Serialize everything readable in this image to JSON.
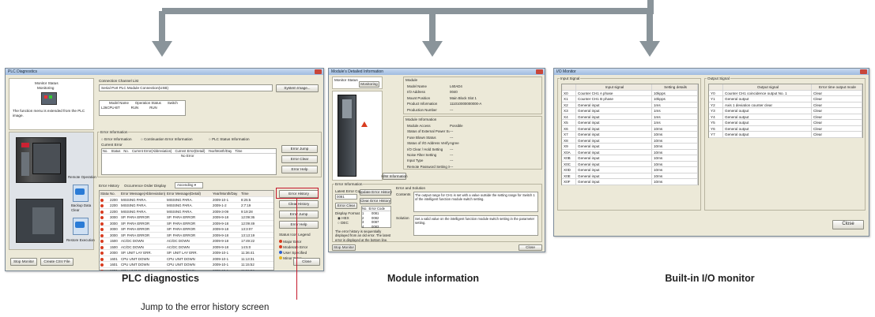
{
  "captions": {
    "plc": "PLC diagnostics",
    "module": "Module information",
    "io": "Built-in I/O monitor",
    "jump": "Jump to the error history screen"
  },
  "plc_window": {
    "title": "PLC Diagnostics",
    "monitor_status": "Monitor Status",
    "monitoring": "Monitoring",
    "function_note": "The function menu is extended from the PLC image.",
    "connection_channel": "Connection Channel List",
    "connection_value": "Serial Port  PLC Module Connection(USB)",
    "system_image": "System Image...",
    "model_headers": [
      "Model Name",
      "Operation Status",
      "Switch"
    ],
    "model_values": [
      "L26CPU-BT",
      "RUN",
      "RUN"
    ],
    "error_information": "Error Information",
    "radio_error": "Error Information",
    "radio_continuation": "Continuation Error Information",
    "radio_status": "PLC Status Information",
    "current_error": "Current Error",
    "ce_headers": [
      "No.",
      "Status",
      "No.",
      "Current Error(Abbreviation)",
      "Current Error(Detail)",
      "Year/Month/Day",
      "Time"
    ],
    "no_error": "No Error",
    "error_jump": "Error Jump",
    "error_clear": "Error Clear",
    "error_help": "Error Help",
    "remote_operation": "Remote Operation",
    "backup_data": "Backup Data Clear",
    "restore_execution": "Restore Execution",
    "error_history": "Error History",
    "occurrence_order": "Occurrence Order Display",
    "order_value": "Ascending",
    "eh_headers": [
      "Status",
      "No.",
      "Error Message(Abbreviation)",
      "Error Message(Detail)",
      "Year/Month/Day",
      "Time"
    ],
    "eh_rows": [
      [
        "2200",
        "MISSING PARA.",
        "MISSING PARA.",
        "2009-10-1",
        "8:25:5"
      ],
      [
        "2200",
        "MISSING PARA.",
        "MISSING PARA.",
        "2009-1-2",
        "2:7:19"
      ],
      [
        "2200",
        "MISSING PARA.",
        "MISSING PARA.",
        "2009-3-09",
        "9:19:28"
      ],
      [
        "3000",
        "SP. PARA ERROR",
        "SP. PARA ERROR",
        "2009-9-18",
        "12:09:36"
      ],
      [
        "3000",
        "SP. PARA ERROR",
        "SP. PARA ERROR",
        "2009-9-18",
        "12:09:49"
      ],
      [
        "3000",
        "SP. PARA ERROR",
        "SP. PARA ERROR",
        "2009-9-18",
        "13:3:07"
      ],
      [
        "3000",
        "SP. PARA ERROR",
        "SP. PARA ERROR",
        "2009-9-18",
        "13:13:19"
      ],
      [
        "1500",
        "AC/DC DOWN",
        "AC/DC DOWN",
        "2009-9-18",
        "17:49:22"
      ],
      [
        "1500",
        "AC/DC DOWN",
        "AC/DC DOWN",
        "2009-9-18",
        "14:5:0"
      ],
      [
        "2000",
        "SP. UNIT LAY ERR.",
        "SP. UNIT LAY ERR.",
        "2009-10-1",
        "11:36:41"
      ],
      [
        "1601",
        "CPU UNIT DOWN",
        "CPU UNIT DOWN",
        "2009-10-1",
        "11:13:31"
      ],
      [
        "1601",
        "CPU UNIT DOWN",
        "CPU UNIT DOWN",
        "2009-10-1",
        "11:15:52"
      ],
      [
        "1601",
        "CPU UNIT DOWN",
        "CPU UNIT DOWN",
        "2009-10-1",
        "11:21:34"
      ]
    ],
    "right_buttons": [
      "Error History",
      "Clear History",
      "Error Jump",
      "Error Help"
    ],
    "status_icon_legend": "Status Icon Legend",
    "legend": [
      "Major Error",
      "Moderate Error",
      "User Specified",
      "Minor Error"
    ],
    "stop_monitor": "Stop Monitor",
    "create_csv": "Create CSV File",
    "close": "Close"
  },
  "module_window": {
    "title": "Module's Detailed Information",
    "monitor_status": "Monitor Status",
    "monitoring": "Monitoring",
    "module_group": "Module",
    "module_rows": [
      [
        "Model Name",
        "L60AD4"
      ],
      [
        "I/O Address",
        "0040"
      ],
      [
        "Mount Position",
        "Main Block Slot 1"
      ],
      [
        "Product Information",
        "111010000000000-A"
      ],
      [
        "Production Number",
        "---"
      ]
    ],
    "module_info_group": "Module Information",
    "info_rows": [
      [
        "Module Access",
        "Possible"
      ],
      [
        "Status of External Power Supply",
        "---"
      ],
      [
        "Fuse Blown Status",
        "---"
      ],
      [
        "Status of I/O Address Verify",
        "Agree"
      ],
      [
        "I/O Clear / Hold Setting",
        "---"
      ],
      [
        "Noise Filter Setting",
        "---"
      ],
      [
        "Input Type",
        "---"
      ],
      [
        "Remote Password Setting Status",
        "---"
      ]
    ],
    "h_w_information": "H/W Information",
    "error_information": "Error Information",
    "latest_error_code": "Latest Error Code",
    "latest_value": "0081",
    "update_error_history": "Update Error History",
    "error_clear": "Error Clear",
    "clear_error_history": "Clear Error History",
    "display_format": "Display Format",
    "hex": "HEX",
    "dec": "DEC",
    "eh_headers": [
      "No.",
      "Error Code"
    ],
    "eh_rows": [
      [
        "1",
        "0081"
      ],
      [
        "2",
        "0082"
      ],
      [
        "3",
        "0087"
      ],
      [
        "4",
        "0083"
      ]
    ],
    "history_note": "The error history is sequentially displayed from an old error. The latest error is displayed at the bottom line.",
    "error_and_solution": "Error and Solution",
    "contents_label": "Contents",
    "contents_text": "The output range for CH1 is set with a value outside the setting range for Switch 1 of the intelligent function module switch setting.",
    "solution_label": "Solution",
    "solution_text": "Set a valid value on the intelligent function module switch setting in the parameter setting.",
    "stop_monitor": "Stop Monitor",
    "close": "Close"
  },
  "io_window": {
    "title": "I/O Monitor",
    "input_group": "Input Signal",
    "input_headers": [
      "",
      "Input signal",
      "Setting details"
    ],
    "input_rows": [
      [
        "X0",
        "Counter CH1 A phase",
        "10kpps"
      ],
      [
        "X1",
        "Counter CH1 B phase",
        "10kpps"
      ],
      [
        "X2",
        "General input",
        "1ms"
      ],
      [
        "X3",
        "General input",
        "1ms"
      ],
      [
        "X4",
        "General input",
        "1ms"
      ],
      [
        "X5",
        "General input",
        "1ms"
      ],
      [
        "X6",
        "General input",
        "10ms"
      ],
      [
        "X7",
        "General input",
        "10ms"
      ],
      [
        "X8",
        "General input",
        "10ms"
      ],
      [
        "X9",
        "General input",
        "10ms"
      ],
      [
        "X0A",
        "General input",
        "10ms"
      ],
      [
        "X0B",
        "General input",
        "10ms"
      ],
      [
        "X0C",
        "General input",
        "10ms"
      ],
      [
        "X0D",
        "General input",
        "10ms"
      ],
      [
        "X0E",
        "General input",
        "10ms"
      ],
      [
        "X0F",
        "General input",
        "10ms"
      ]
    ],
    "output_group": "Output Signal",
    "output_headers": [
      "",
      "Output signal",
      "Error time output mode"
    ],
    "output_rows": [
      [
        "Y0",
        "Counter CH1 coincidence output No. 1",
        "Clear"
      ],
      [
        "Y1",
        "General output",
        "Clear"
      ],
      [
        "Y2",
        "Axis 1 deviation counter clear",
        "Clear"
      ],
      [
        "Y3",
        "General output",
        "Clear"
      ],
      [
        "Y4",
        "General output",
        "Clear"
      ],
      [
        "Y5",
        "General output",
        "Clear"
      ],
      [
        "Y6",
        "General output",
        "Clear"
      ],
      [
        "Y7",
        "General output",
        "Clear"
      ]
    ],
    "close": "Close"
  },
  "colors": {
    "connector": "#8a949a",
    "highlight": "#c4182b",
    "window_bg": "#ece9d8"
  }
}
